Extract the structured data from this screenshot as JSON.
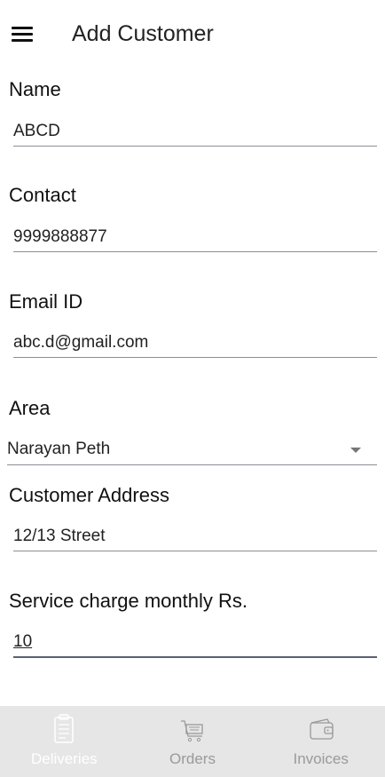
{
  "header": {
    "title": "Add Customer",
    "menu_icon": "hamburger-menu-icon"
  },
  "form": {
    "name": {
      "label": "Name",
      "value": "ABCD"
    },
    "contact": {
      "label": "Contact",
      "value": "9999888877"
    },
    "email": {
      "label": "Email ID",
      "value": "abc.d@gmail.com"
    },
    "area": {
      "label": "Area",
      "selected": "Narayan Peth"
    },
    "address": {
      "label": "Customer Address",
      "value": "12/13 Street"
    },
    "service_charge": {
      "label": "Service charge monthly Rs.",
      "value": "10"
    }
  },
  "tabs": [
    {
      "label": "Deliveries",
      "icon": "clipboard-icon",
      "active": true
    },
    {
      "label": "Orders",
      "icon": "shopping-cart-icon",
      "active": false
    },
    {
      "label": "Invoices",
      "icon": "wallet-icon",
      "active": false
    }
  ],
  "colors": {
    "tab_bar_background": "#e6e6e6",
    "active_tab": "#ffffff",
    "inactive_tab": "#9a9a9a",
    "underline": "#8a8f96"
  }
}
